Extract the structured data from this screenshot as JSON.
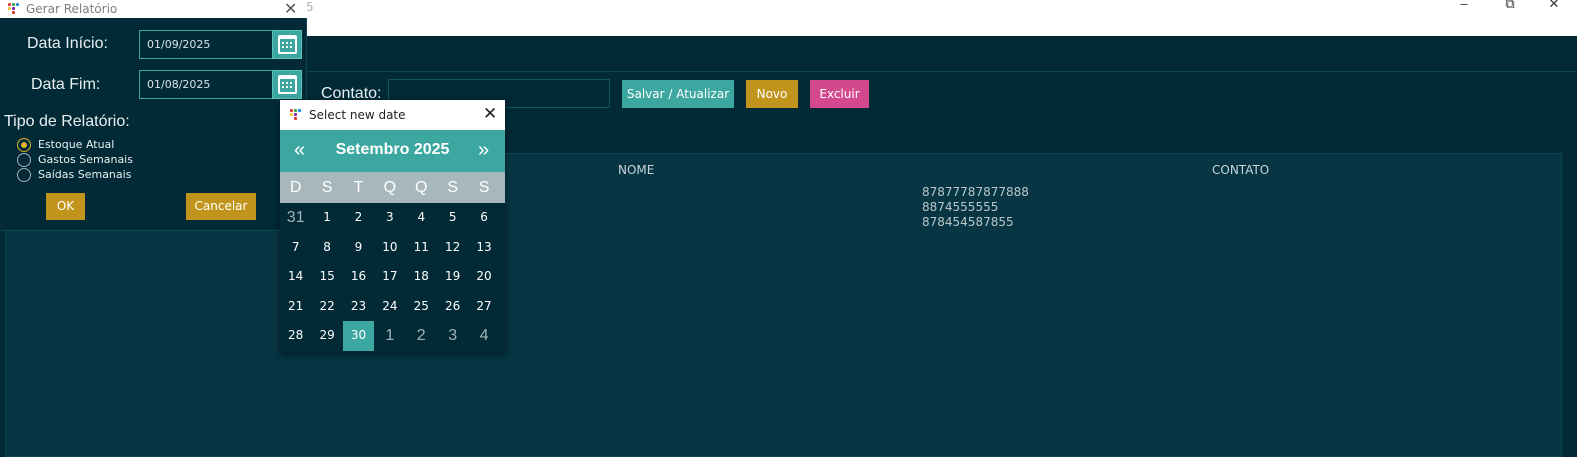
{
  "main_window": {
    "title": "5",
    "controls": {
      "minimize": "–",
      "maximize": "⧉",
      "close": "✕"
    },
    "contato_label": "Contato:",
    "contato_value": "",
    "buttons": {
      "salvar": "Salvar / Atualizar",
      "novo": "Novo",
      "excluir": "Excluir"
    },
    "colors": {
      "salvar": "#3ca7a0",
      "novo": "#c1951c",
      "excluir": "#d4498e",
      "background": "#012a36"
    },
    "grid": {
      "headers": [
        "NOME",
        "CONTATO"
      ],
      "contatos": [
        "87877787877888",
        "8874555555",
        "878454587855"
      ]
    }
  },
  "report_dialog": {
    "title": "Gerar Relatório",
    "close": "✕",
    "data_inicio_label": "Data Início:",
    "data_inicio_value": "01/09/2025",
    "data_fim_label": "Data Fim:",
    "data_fim_value": "01/08/2025",
    "tipo_label": "Tipo de Relatório:",
    "options": [
      {
        "label": "Estoque Atual",
        "selected": true
      },
      {
        "label": "Gastos Semanais",
        "selected": false
      },
      {
        "label": "Saídas Semanais",
        "selected": false
      }
    ],
    "ok": "OK",
    "cancelar": "Cancelar"
  },
  "date_picker": {
    "title": "Select new date",
    "close": "✕",
    "prev": "«",
    "next": "»",
    "month": "Setembro 2025",
    "weekdays": [
      "D",
      "S",
      "T",
      "Q",
      "Q",
      "S",
      "S"
    ],
    "weeks": [
      [
        "31",
        "1",
        "2",
        "3",
        "4",
        "5",
        "6"
      ],
      [
        "7",
        "8",
        "9",
        "10",
        "11",
        "12",
        "13"
      ],
      [
        "14",
        "15",
        "16",
        "17",
        "18",
        "19",
        "20"
      ],
      [
        "21",
        "22",
        "23",
        "24",
        "25",
        "26",
        "27"
      ],
      [
        "28",
        "29",
        "30",
        "1",
        "2",
        "3",
        "4"
      ]
    ],
    "selected_day": "30"
  }
}
